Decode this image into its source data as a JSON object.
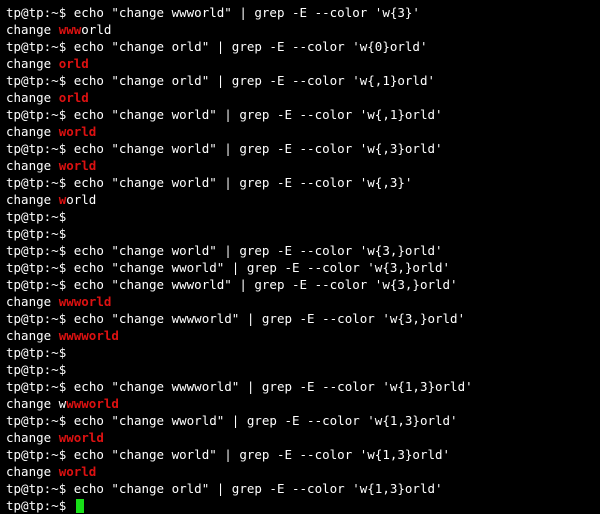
{
  "prompt": {
    "user": "tp@tp",
    "sep": ":",
    "path": "~",
    "dollar": "$"
  },
  "lines": [
    {
      "t": "cmd",
      "text": "echo \"change wwworld\" | grep -E --color 'w{3}'"
    },
    {
      "t": "out",
      "segs": [
        {
          "s": "change ",
          "h": 0
        },
        {
          "s": "www",
          "h": 1
        },
        {
          "s": "orld",
          "h": 0
        }
      ]
    },
    {
      "t": "cmd",
      "text": "echo \"change orld\" | grep -E --color 'w{0}orld'"
    },
    {
      "t": "out",
      "segs": [
        {
          "s": "change ",
          "h": 0
        },
        {
          "s": "orld",
          "h": 1
        }
      ]
    },
    {
      "t": "cmd",
      "text": "echo \"change orld\" | grep -E --color 'w{,1}orld'"
    },
    {
      "t": "out",
      "segs": [
        {
          "s": "change ",
          "h": 0
        },
        {
          "s": "orld",
          "h": 1
        }
      ]
    },
    {
      "t": "cmd",
      "text": "echo \"change world\" | grep -E --color 'w{,1}orld'"
    },
    {
      "t": "out",
      "segs": [
        {
          "s": "change ",
          "h": 0
        },
        {
          "s": "world",
          "h": 1
        }
      ]
    },
    {
      "t": "cmd",
      "text": "echo \"change world\" | grep -E --color 'w{,3}orld'"
    },
    {
      "t": "out",
      "segs": [
        {
          "s": "change ",
          "h": 0
        },
        {
          "s": "world",
          "h": 1
        }
      ]
    },
    {
      "t": "cmd",
      "text": "echo \"change world\" | grep -E --color 'w{,3}'"
    },
    {
      "t": "out",
      "segs": [
        {
          "s": "change ",
          "h": 0
        },
        {
          "s": "w",
          "h": 1
        },
        {
          "s": "orld",
          "h": 0
        }
      ]
    },
    {
      "t": "cmd",
      "text": ""
    },
    {
      "t": "cmd",
      "text": ""
    },
    {
      "t": "cmd",
      "text": "echo \"change world\" | grep -E --color 'w{3,}orld'"
    },
    {
      "t": "cmd",
      "text": "echo \"change wworld\" | grep -E --color 'w{3,}orld'"
    },
    {
      "t": "cmd",
      "text": "echo \"change wwworld\" | grep -E --color 'w{3,}orld'"
    },
    {
      "t": "out",
      "segs": [
        {
          "s": "change ",
          "h": 0
        },
        {
          "s": "wwworld",
          "h": 1
        }
      ]
    },
    {
      "t": "cmd",
      "text": "echo \"change wwwworld\" | grep -E --color 'w{3,}orld'"
    },
    {
      "t": "out",
      "segs": [
        {
          "s": "change ",
          "h": 0
        },
        {
          "s": "wwwworld",
          "h": 1
        }
      ]
    },
    {
      "t": "cmd",
      "text": ""
    },
    {
      "t": "cmd",
      "text": ""
    },
    {
      "t": "cmd",
      "text": "echo \"change wwwworld\" | grep -E --color 'w{1,3}orld'"
    },
    {
      "t": "out",
      "segs": [
        {
          "s": "change w",
          "h": 0
        },
        {
          "s": "wwworld",
          "h": 1
        }
      ]
    },
    {
      "t": "cmd",
      "text": "echo \"change wworld\" | grep -E --color 'w{1,3}orld'"
    },
    {
      "t": "out",
      "segs": [
        {
          "s": "change ",
          "h": 0
        },
        {
          "s": "wworld",
          "h": 1
        }
      ]
    },
    {
      "t": "cmd",
      "text": "echo \"change world\" | grep -E --color 'w{1,3}orld'"
    },
    {
      "t": "out",
      "segs": [
        {
          "s": "change ",
          "h": 0
        },
        {
          "s": "world",
          "h": 1
        }
      ]
    },
    {
      "t": "cmd",
      "text": "echo \"change orld\" | grep -E --color 'w{1,3}orld'"
    },
    {
      "t": "prompt-only"
    }
  ]
}
